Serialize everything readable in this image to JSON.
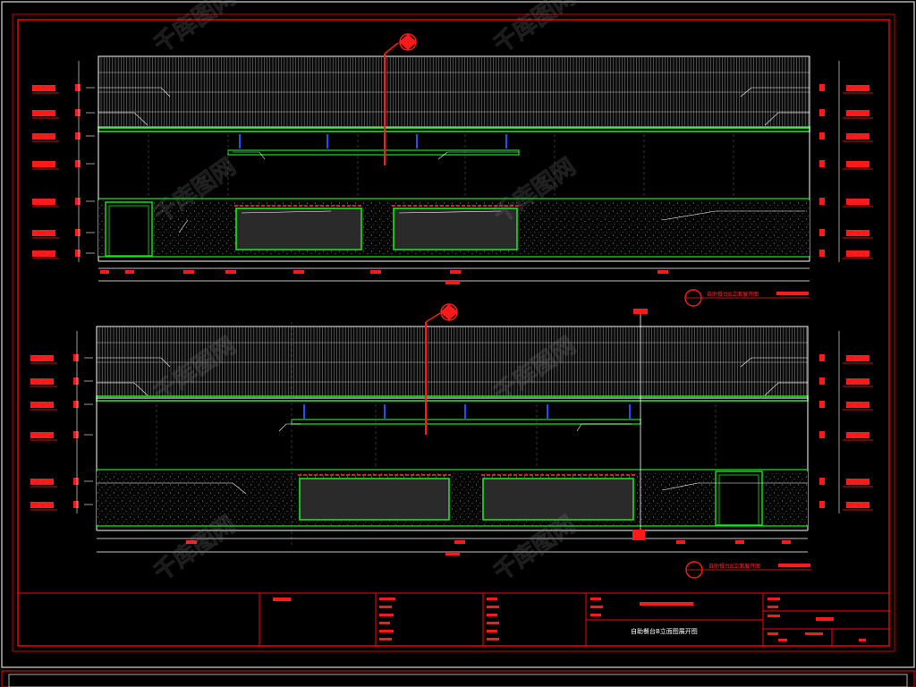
{
  "drawing": {
    "title_block_name": "自助餐台B立面图展开图",
    "colors": {
      "background": "#000000",
      "frame": "#ff0000",
      "inner_frame": "#d9d9d9",
      "outline": "#ffffff",
      "green": "#19e619",
      "blue": "#1f4dff",
      "red": "#ff1a1a",
      "glass": "#2a2a2a"
    },
    "elevation_tags": [
      {
        "label": "自助餐台B立面展开图"
      },
      {
        "label": "自助餐台B立面展开图"
      }
    ]
  },
  "watermark": {
    "text": "千库图网"
  }
}
